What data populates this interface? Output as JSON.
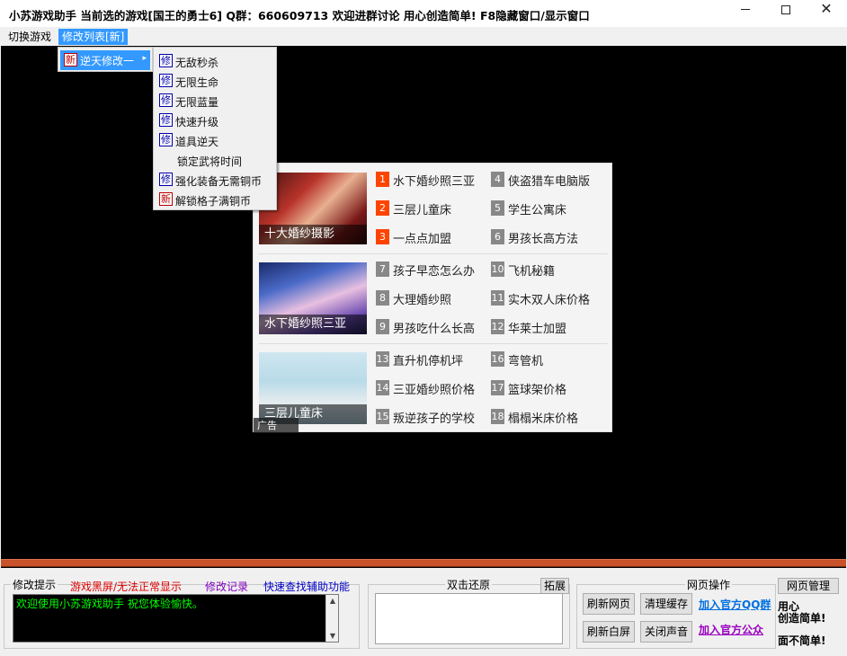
{
  "window": {
    "title": "小苏游戏助手 当前选的游戏[国王的勇士6] Q群：660609713 欢迎进群讨论  用心创造简单!    F8隐藏窗口/显示窗口",
    "minimize_icon": "minimize-icon",
    "maximize_icon": "maximize-icon",
    "close_icon": "close-icon"
  },
  "menubar": {
    "items": [
      {
        "label": "切换游戏"
      },
      {
        "label": "修改列表[新]"
      }
    ]
  },
  "menu_level1": {
    "items": [
      {
        "tag": "新",
        "label": "逆天修改一",
        "arrow": "▸"
      }
    ]
  },
  "menu_level2": {
    "items": [
      {
        "tag": "修",
        "label": "无敌秒杀"
      },
      {
        "tag": "修",
        "label": "无限生命"
      },
      {
        "tag": "修",
        "label": "无限蓝量"
      },
      {
        "tag": "修",
        "label": "快速升级"
      },
      {
        "tag": "修",
        "label": "道具逆天"
      },
      {
        "tag": "",
        "label": "锁定武将时间"
      },
      {
        "tag": "修",
        "label": "强化装备无需铜币"
      },
      {
        "tag": "新",
        "label": "解锁格子满铜币"
      }
    ]
  },
  "ad": {
    "thumbs": [
      {
        "caption": "十大婚纱摄影"
      },
      {
        "caption": "水下婚纱照三亚"
      },
      {
        "caption": "三层儿童床"
      }
    ],
    "badge": "广告",
    "links": [
      {
        "num": "1",
        "text": "水下婚纱照三亚",
        "hot": true
      },
      {
        "num": "2",
        "text": "三层儿童床",
        "hot": true
      },
      {
        "num": "3",
        "text": "一点点加盟",
        "hot": true
      },
      {
        "num": "4",
        "text": "侠盗猎车电脑版",
        "hot": false
      },
      {
        "num": "5",
        "text": "学生公寓床",
        "hot": false
      },
      {
        "num": "6",
        "text": "男孩长高方法",
        "hot": false
      },
      {
        "num": "7",
        "text": "孩子早恋怎么办",
        "hot": false
      },
      {
        "num": "8",
        "text": "大理婚纱照",
        "hot": false
      },
      {
        "num": "9",
        "text": "男孩吃什么长高",
        "hot": false
      },
      {
        "num": "10",
        "text": "飞机秘籍",
        "hot": false
      },
      {
        "num": "11",
        "text": "实木双人床价格",
        "hot": false
      },
      {
        "num": "12",
        "text": "华莱士加盟",
        "hot": false
      },
      {
        "num": "13",
        "text": "直升机停机坪",
        "hot": false
      },
      {
        "num": "14",
        "text": "三亚婚纱照价格",
        "hot": false
      },
      {
        "num": "15",
        "text": "叛逆孩子的学校",
        "hot": false
      },
      {
        "num": "16",
        "text": "弯管机",
        "hot": false
      },
      {
        "num": "17",
        "text": "篮球架价格",
        "hot": false
      },
      {
        "num": "18",
        "text": "榻榻米床价格",
        "hot": false
      }
    ]
  },
  "bottom": {
    "tips_title": "修改提示",
    "link_blackscreen": "游戏黑屏/无法正常显示",
    "link_records": "修改记录",
    "link_find": "快速查找辅助功能",
    "log_text": "欢迎使用小苏游戏助手 祝您体验愉快。",
    "restore_title": "双击还原",
    "expand_label": "拓展",
    "web_ops_title": "网页操作",
    "web_manage_label": "网页管理",
    "btn_refresh_page": "刷新网页",
    "btn_clear_cache": "清理缓存",
    "btn_refresh_blank": "刷新白屏",
    "btn_mute": "关闭声音",
    "link_qq_group": "加入官方QQ群",
    "link_join_official": "加入官方公众",
    "side_line1": "用心",
    "side_line2": "创造简单!",
    "side_line3": "面不简单!"
  },
  "colors": {
    "menu_highlight": "#3399ff",
    "hot_badge": "#ff4400",
    "log_text": "#00ff00",
    "orange_bar": "#c8532b"
  }
}
